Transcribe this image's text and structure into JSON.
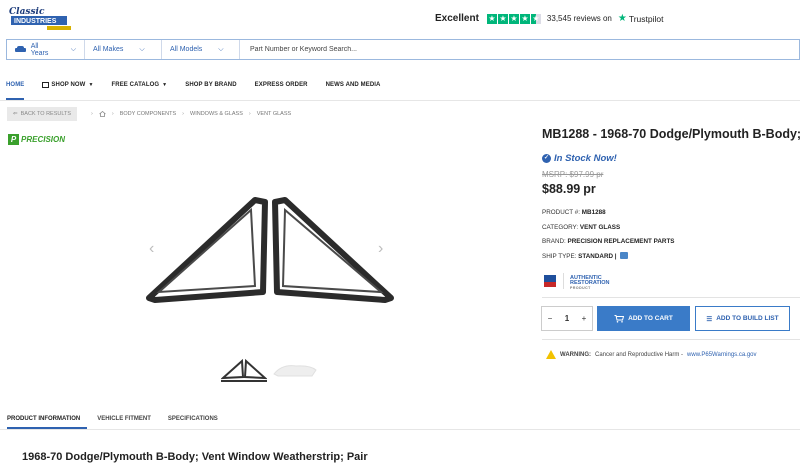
{
  "header": {
    "logo_text": "Classic Industries",
    "trust": {
      "rating_word": "Excellent",
      "reviews": "33,545 reviews on",
      "brand": "Trustpilot",
      "stars": 4.5
    }
  },
  "search": {
    "years": "All Years",
    "makes": "All Makes",
    "models": "All Models",
    "placeholder": "Part Number or Keyword Search..."
  },
  "nav": {
    "items": [
      {
        "label": "HOME",
        "active": true
      },
      {
        "label": "SHOP NOW",
        "has_menu": true
      },
      {
        "label": "FREE CATALOG",
        "has_menu": true
      },
      {
        "label": "SHOP BY BRAND"
      },
      {
        "label": "EXPRESS ORDER"
      },
      {
        "label": "NEWS AND MEDIA"
      }
    ]
  },
  "breadcrumb": {
    "back": "BACK TO RESULTS",
    "items": [
      "BODY COMPONENTS",
      "WINDOWS & GLASS",
      "VENT GLASS"
    ]
  },
  "brand_logo": "PRECISION",
  "product": {
    "title": "MB1288 - 1968-70 Dodge/Plymouth B-Body;",
    "stock": "In Stock Now!",
    "msrp": "MSRP: $97.99 pr",
    "price": "$88.99",
    "price_unit": "pr",
    "specs": {
      "part_label": "PRODUCT #:",
      "part_value": "MB1288",
      "category_label": "CATEGORY:",
      "category_value": "VENT GLASS",
      "brand_label": "BRAND:",
      "brand_value": "PRECISION REPLACEMENT PARTS",
      "ship_label": "SHIP TYPE:",
      "ship_value": "STANDARD |"
    },
    "badge_top": "AUTHENTIC",
    "badge_mid": "RESTORATION",
    "badge_bottom": "PRODUCT",
    "quantity": "1",
    "add_to_cart": "ADD TO CART",
    "add_to_build": "ADD TO BUILD LIST",
    "warning_label": "WARNING:",
    "warning_text": "Cancer and Reproductive Harm -",
    "warning_link": "www.P65Warnings.ca.gov"
  },
  "tabs": [
    {
      "label": "PRODUCT INFORMATION",
      "active": true
    },
    {
      "label": "VEHICLE FITMENT"
    },
    {
      "label": "SPECIFICATIONS"
    }
  ],
  "bottom_title": "1968-70 Dodge/Plymouth B-Body; Vent Window Weatherstrip; Pair",
  "colors": {
    "accent": "#2f62b0",
    "button": "#3a7bc8",
    "trustpilot": "#00b67a",
    "precision": "#3aa02c"
  }
}
